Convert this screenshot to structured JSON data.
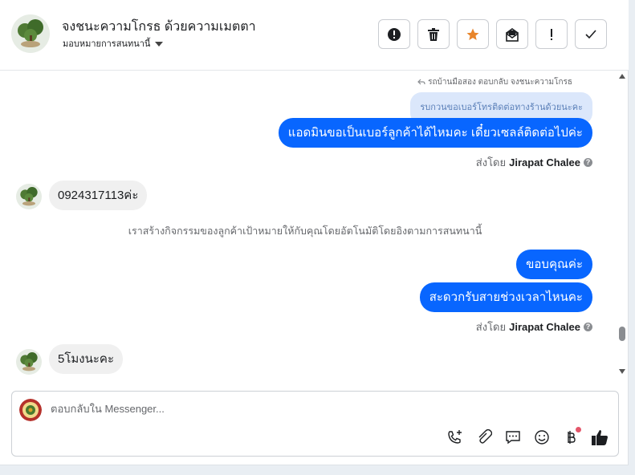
{
  "header": {
    "contact_name": "จงชนะความโกรธ ด้วยความเมตตา",
    "assign_label": "มอบหมายการสนทนานี้",
    "actions": [
      {
        "name": "report-button",
        "icon": "alert-circle-icon"
      },
      {
        "name": "delete-button",
        "icon": "trash-icon"
      },
      {
        "name": "star-button",
        "icon": "star-icon"
      },
      {
        "name": "mark-unread-button",
        "icon": "mail-open-icon"
      },
      {
        "name": "important-button",
        "icon": "exclamation-icon"
      },
      {
        "name": "done-button",
        "icon": "check-icon"
      }
    ]
  },
  "thread": {
    "reply_note": "รถบ้านมือสอง ตอบกลับ จงชนะความโกรธ",
    "quoted_text": "รบกวนขอเบอร์โทรติดต่อทางร้านด้วยนะคะ",
    "messages": {
      "out1": "แอดมินขอเป็นเบอร์ลูกค้าได้ไหมคะ เดี๋ยวเซลล์ติดต่อไปค่ะ",
      "sent_by_prefix": "ส่งโดย",
      "sent_by_name": "Jirapat Chalee",
      "in1": "0924317113ค่ะ",
      "system_note": "เราสร้างกิจกรรมของลูกค้าเป้าหมายให้กับคุณโดยอัตโนมัติโดยอิงตามการสนทนานี้",
      "out2": "ขอบคุณค่ะ",
      "out3": "สะดวกรับสายช่วงเวลาไหนคะ",
      "in2": "5โมงนะคะ"
    }
  },
  "composer": {
    "placeholder": "ตอบกลับใน Messenger...",
    "tools": [
      "phone-plus-icon",
      "paperclip-icon",
      "chat-bubble-icon",
      "smiley-icon",
      "baht-icon",
      "thumbs-up-icon"
    ]
  },
  "colors": {
    "accent": "#0866ff",
    "incoming_bubble": "#f0f0f0",
    "quoted_bubble": "#dbe7fb",
    "star": "#e8852b"
  }
}
